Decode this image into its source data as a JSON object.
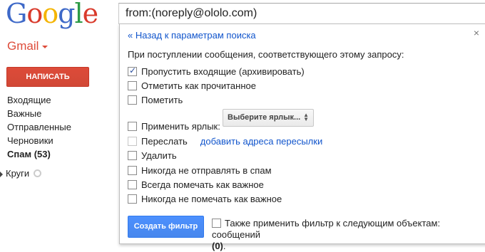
{
  "logo": {
    "text": "Google"
  },
  "search": {
    "value": "from:(noreply@ololo.com)"
  },
  "nav": {
    "brand": "Gmail",
    "compose_label": "НАПИСАТЬ",
    "items": [
      {
        "label": "Входящие"
      },
      {
        "label": "Важные"
      },
      {
        "label": "Отправленные"
      },
      {
        "label": "Черновики"
      },
      {
        "label": "Спам (53)"
      }
    ],
    "circles_label": "Круги"
  },
  "filter": {
    "back_link": "« Назад к параметрам поиска",
    "close_symbol": "×",
    "intro": "При поступлении сообщения, соответствующего этому запросу:",
    "options": {
      "skip_inbox": {
        "label": "Пропустить входящие (архивировать)",
        "checked": true
      },
      "mark_read": {
        "label": "Отметить как прочитанное",
        "checked": false
      },
      "star": {
        "label": "Пометить",
        "checked": false
      },
      "apply_label": {
        "label": "Применить ярлык:",
        "checked": false
      },
      "forward": {
        "label": "Переслать",
        "checked": false,
        "disabled": true
      },
      "delete": {
        "label": "Удалить",
        "checked": false
      },
      "never_spam": {
        "label": "Никогда не отправлять в спам",
        "checked": false
      },
      "always_important": {
        "label": "Всегда помечать как важное",
        "checked": false
      },
      "never_important": {
        "label": "Никогда не помечать как важное",
        "checked": false
      }
    },
    "label_select": "Выберите ярлык...",
    "forward_link": "добавить адреса пересылки",
    "create_button": "Создать фильтр",
    "also_apply_line1": "Также применить фильтр к следующим объектам: сообщений",
    "also_apply_count": "(0)",
    "also_apply_end": "."
  },
  "colors": {
    "compose": "#d14836",
    "link": "#1155cc",
    "primary_button": "#4d90fe",
    "gmail_brand": "#dd4b39"
  }
}
